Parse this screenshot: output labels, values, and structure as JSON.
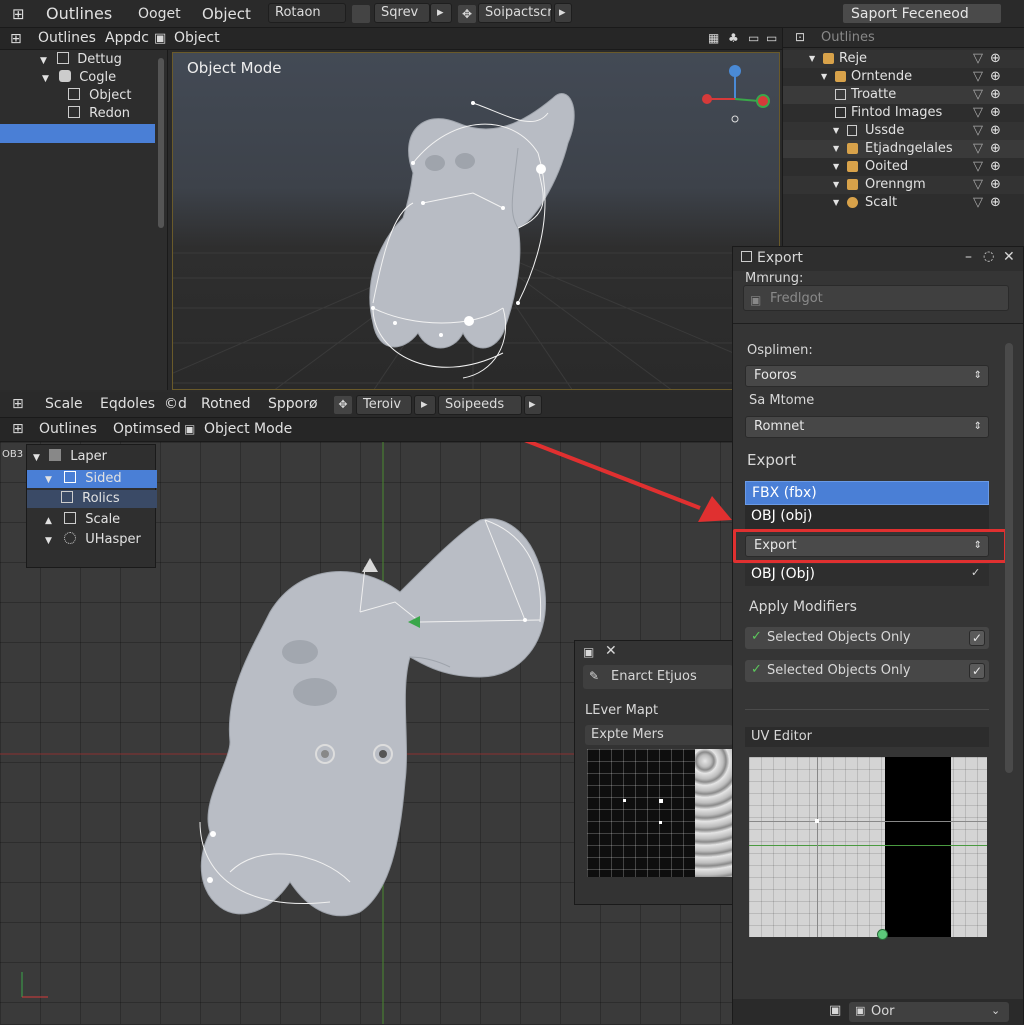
{
  "topbar": {
    "menu": [
      "Outlines",
      "Ooget",
      "Object",
      "Rotaon"
    ],
    "btn1": "Sqrev",
    "btn2": "Soipactscr",
    "search": "Saport Feceneod"
  },
  "left_outliner": {
    "tabs": [
      "Outlines",
      "Appdc"
    ],
    "items": [
      "Dettug",
      "Cogle",
      "Object",
      "Redon"
    ]
  },
  "viewport_top": {
    "header": "Object",
    "mode": "Object Mode"
  },
  "right_outliner": {
    "title": "Outlines",
    "items": [
      "Reje",
      "Orntende",
      "Troatte",
      "Fintod Images",
      "Ussde",
      "Etjadngelales",
      "Ooited",
      "Orenngm",
      "Scalt"
    ]
  },
  "mid_toolbar": {
    "menu": [
      "Scale",
      "Eqdoles",
      "©d",
      "Rotned",
      "Spporø"
    ],
    "btn1": "Teroiv",
    "btn2": "Soipeeds"
  },
  "lower_header": {
    "tabs": [
      "Outlines",
      "Optimsed"
    ],
    "mode": "Object Mode"
  },
  "obj_label": "OB3",
  "layer_panel": {
    "items": [
      "Laper",
      "Sided",
      "Rolics",
      "Scale",
      "UHasper"
    ]
  },
  "export_panel": {
    "title": "Export",
    "section1": "Mmrung:",
    "field1": "Fredlgot",
    "label1": "Osplimen:",
    "field2": "Fooros",
    "label2": "Sa Mtome",
    "field3": "Romnet",
    "format_label": "Export",
    "formats": [
      "FBX (fbx)",
      "OBJ (obj)"
    ],
    "export_button": "Export",
    "format_dropdown": "OBJ (Obj)",
    "apply_modifiers": "Apply Modifiers",
    "checks": [
      "Selected Objects Only",
      "Selected Objects Only"
    ],
    "uv_editor": "UV Editor"
  },
  "small_panel": {
    "title": "Enarct Etjuos",
    "row1": "LEver Mapt",
    "row2": "Expte Mers"
  },
  "bottom_right": {
    "label": "Oor"
  },
  "colors": {
    "accent": "#4a7fd6",
    "highlight": "#e03030",
    "bg": "#2b2b2b"
  }
}
